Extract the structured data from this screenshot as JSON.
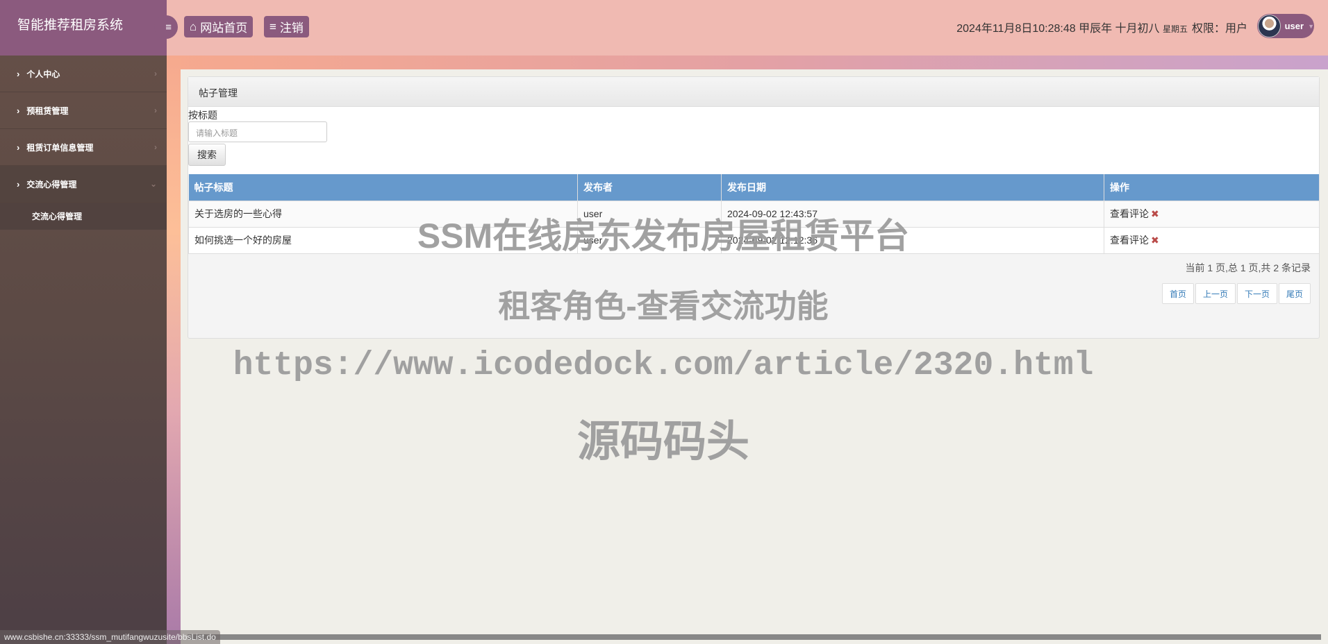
{
  "app": {
    "title": "智能推荐租房系统"
  },
  "sidebar": {
    "items": [
      {
        "label": "个人中心"
      },
      {
        "label": "预租赁管理"
      },
      {
        "label": "租赁订单信息管理"
      },
      {
        "label": "交流心得管理",
        "sub": [
          {
            "label": "交流心得管理"
          }
        ]
      }
    ]
  },
  "header": {
    "home_label": "网站首页",
    "logout_label": "注销",
    "datetime": "2024年11月8日10:28:48 甲辰年 十月初八",
    "weekday": "星期五",
    "permission": "权限：用户",
    "username": "user"
  },
  "panel": {
    "title": "帖子管理",
    "search_label": "按标题",
    "search_placeholder": "请输入标题",
    "search_button": "搜索"
  },
  "table": {
    "columns": [
      "帖子标题",
      "发布者",
      "发布日期",
      "操作"
    ],
    "rows": [
      {
        "title": "关于选房的一些心得",
        "author": "user",
        "date": "2024-09-02 12:43:57",
        "action": "查看评论"
      },
      {
        "title": "如何挑选一个好的房屋",
        "author": "user",
        "date": "2024-09-02 12:12:36",
        "action": "查看评论"
      }
    ]
  },
  "pagination": {
    "info": "当前 1 页,总 1 页,共 2 条记录",
    "first": "首页",
    "prev": "上一页",
    "next": "下一页",
    "last": "尾页"
  },
  "watermark": {
    "line1": "SSM在线房东发布房屋租赁平台",
    "line2": "租客角色-查看交流功能",
    "line3": "https://www.icodedock.com/article/2320.html",
    "line4": "源码码头"
  },
  "status_url": "www.csbishe.cn:33333/ssm_mutifangwuzusite/bbsList.do",
  "colors": {
    "brand": "#8b5a7e",
    "header_bg": "#f0bab2",
    "table_header": "#6699cc",
    "delete": "#b94a48"
  }
}
